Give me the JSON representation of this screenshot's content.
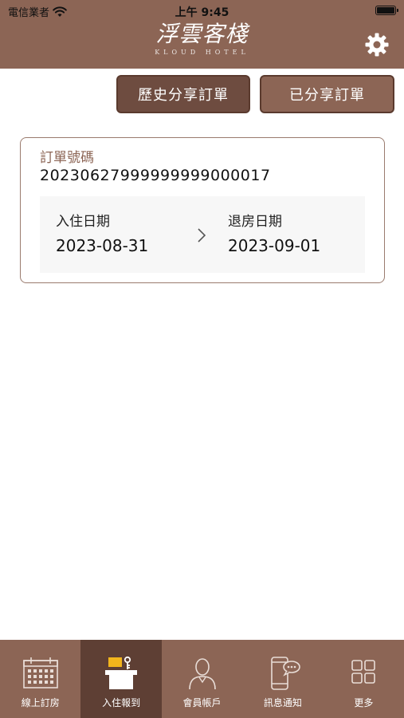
{
  "status_bar": {
    "carrier": "電信業者",
    "time": "上午 9:45"
  },
  "header": {
    "logo_cn": "浮雲客棧",
    "logo_en": "KLOUD HOTEL",
    "settings_icon": "gear-icon"
  },
  "tabs": {
    "history": "歷史分享訂單",
    "shared": "已分享訂單"
  },
  "order": {
    "number_label": "訂單號碼",
    "number": "20230627999999999000017",
    "checkin_label": "入住日期",
    "checkin_date": "2023-08-31",
    "checkout_label": "退房日期",
    "checkout_date": "2023-09-01"
  },
  "tabbar": {
    "items": [
      {
        "label": "線上訂房",
        "icon": "calendar-icon"
      },
      {
        "label": "入住報到",
        "icon": "reception-desk-icon"
      },
      {
        "label": "會員帳戶",
        "icon": "person-icon"
      },
      {
        "label": "訊息通知",
        "icon": "phone-chat-icon"
      },
      {
        "label": "更多",
        "icon": "grid-icon"
      }
    ],
    "active_index": 1
  },
  "colors": {
    "brand": "#8c6555",
    "brand_dark": "#5e3f34",
    "accent_yellow": "#f2b51c"
  }
}
